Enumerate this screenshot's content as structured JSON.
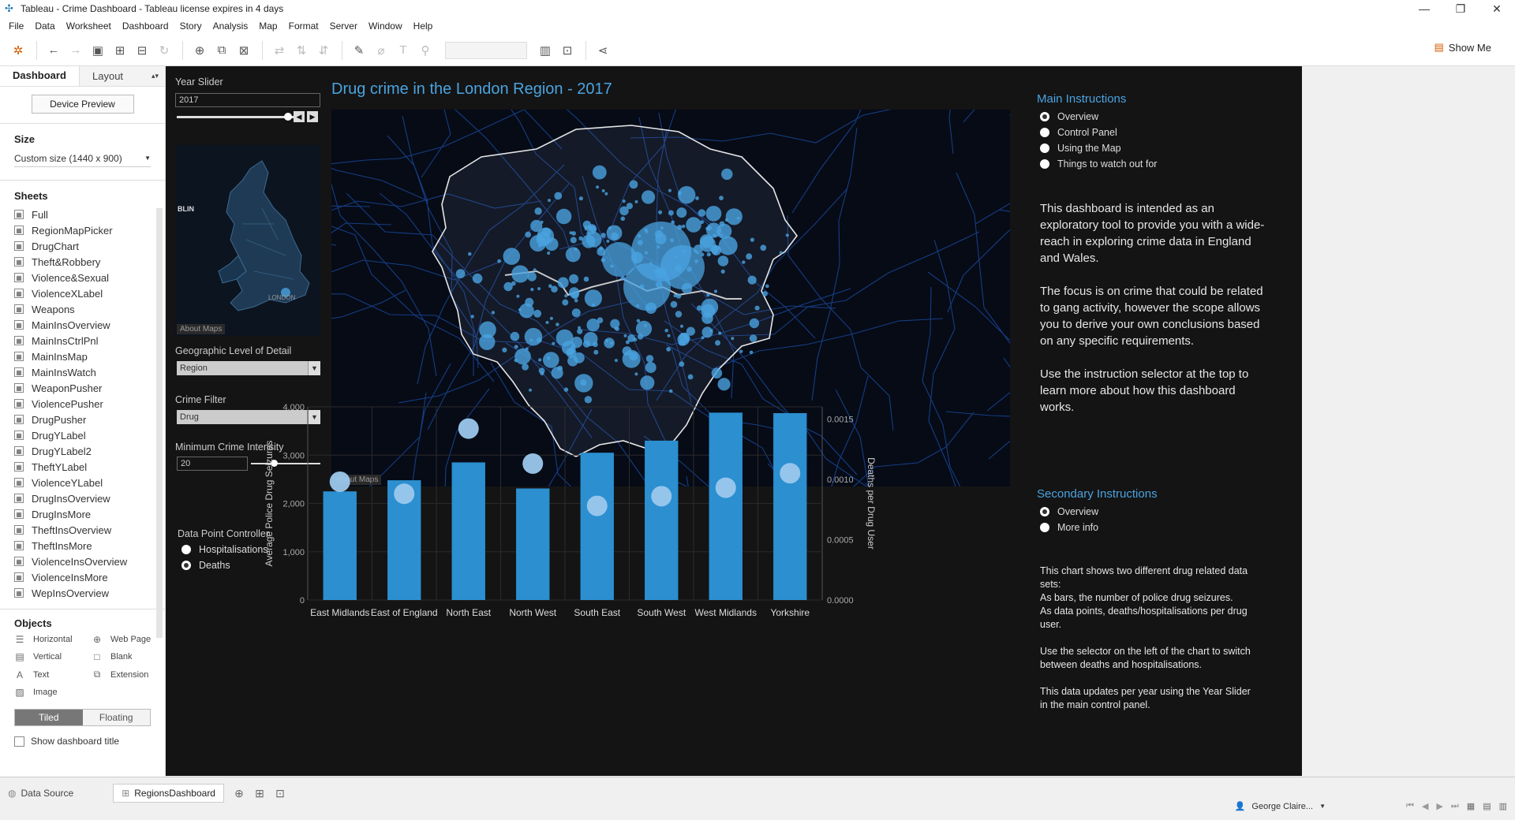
{
  "window": {
    "title": "Tableau - Crime Dashboard - Tableau license expires in 4 days",
    "controls": [
      "—",
      "❐",
      "✕"
    ]
  },
  "menu": [
    "File",
    "Data",
    "Worksheet",
    "Dashboard",
    "Story",
    "Analysis",
    "Map",
    "Format",
    "Server",
    "Window",
    "Help"
  ],
  "toolbar": {
    "show_me": "Show Me"
  },
  "left": {
    "tab_dashboard": "Dashboard",
    "tab_layout": "Layout",
    "device_preview": "Device Preview",
    "size_heading": "Size",
    "size_value": "Custom size (1440 x 900)",
    "sheets_heading": "Sheets",
    "sheets": [
      "Full",
      "RegionMapPicker",
      "DrugChart",
      "Theft&Robbery",
      "Violence&Sexual",
      "ViolenceXLabel",
      "Weapons",
      "MainInsOverview",
      "MainInsCtrlPnl",
      "MainInsMap",
      "MainInsWatch",
      "WeaponPusher",
      "ViolencePusher",
      "DrugPusher",
      "DrugYLabel",
      "DrugYLabel2",
      "TheftYLabel",
      "ViolenceYLabel",
      "DrugInsOverview",
      "DrugInsMore",
      "TheftInsOverview",
      "TheftInsMore",
      "ViolenceInsOverview",
      "ViolenceInsMore",
      "WepInsOverview"
    ],
    "objects_heading": "Objects",
    "objects": [
      {
        "label": "Horizontal",
        "icon": "horizontal-icon"
      },
      {
        "label": "Web Page",
        "icon": "globe-icon"
      },
      {
        "label": "Vertical",
        "icon": "vertical-icon"
      },
      {
        "label": "Blank",
        "icon": "blank-icon"
      },
      {
        "label": "Text",
        "icon": "text-icon"
      },
      {
        "label": "Extension",
        "icon": "extension-icon"
      },
      {
        "label": "Image",
        "icon": "image-icon"
      }
    ],
    "tiled": "Tiled",
    "floating": "Floating",
    "show_title": "Show dashboard title"
  },
  "dashboard": {
    "title": "Drug crime in the London Region - 2017",
    "year_slider_label": "Year Slider",
    "year_value": "2017",
    "minimap_labels": {
      "left": "BLIN",
      "right": "LONDON"
    },
    "about_maps": "About Maps",
    "geo_label": "Geographic Level of Detail",
    "geo_value": "Region",
    "crime_filter_label": "Crime Filter",
    "crime_filter_value": "Drug",
    "min_intensity_label": "Minimum Crime Intensity",
    "min_intensity_value": "20",
    "dpc_label": "Data Point Controller",
    "dpc_options": [
      "Hospitalisations",
      "Deaths"
    ],
    "dpc_selected": 1,
    "main_instr_title": "Main Instructions",
    "main_instr_options": [
      "Overview",
      "Control Panel",
      "Using the Map",
      "Things to watch out for"
    ],
    "main_instr_selected": 0,
    "main_text": [
      "This dashboard is intended as an exploratory tool to provide you with a wide-reach in exploring crime data in England and Wales.",
      "The focus is on crime that could be related to gang activity, however the scope allows you to derive your own conclusions based on any specific requirements.",
      "Use the instruction selector at the top to learn more about how this dashboard works."
    ],
    "sec_instr_title": "Secondary Instructions",
    "sec_instr_options": [
      "Overview",
      "More info"
    ],
    "sec_instr_selected": 0,
    "sec_text": [
      "This chart shows two different drug related data sets:",
      "As bars, the number of police drug seizures.",
      "As data points, deaths/hospitalisations per drug user.",
      "Use the selector on the left of the chart to switch between deaths and hospitalisations.",
      "This data updates per year using the Year Slider in the main control panel."
    ]
  },
  "chart_data": {
    "type": "bar",
    "categories": [
      "East Midlands",
      "East of England",
      "North East",
      "North West",
      "South East",
      "South West",
      "West Midlands",
      "Yorkshire"
    ],
    "series": [
      {
        "name": "Average Police Drug Seizures",
        "values": [
          2250,
          2480,
          2850,
          2310,
          3050,
          3300,
          3880,
          3870
        ],
        "axis": "left"
      },
      {
        "name": "Deaths per Drug User",
        "values": [
          0.00098,
          0.00088,
          0.00142,
          0.00113,
          0.00078,
          0.00086,
          0.00093,
          0.00105
        ],
        "axis": "right"
      }
    ],
    "ylabel": "Average Police Drug Seizures",
    "y2label": "Deaths per Drug User",
    "ylim": [
      0,
      4000
    ],
    "y2lim": [
      0,
      0.0016
    ],
    "yticks": [
      "0",
      "1,000",
      "2,000",
      "3,000",
      "4,000"
    ],
    "y2ticks": [
      "0.0000",
      "0.0005",
      "0.0010",
      "0.0015"
    ],
    "colors": {
      "bar": "#2b8fd0",
      "point": "#9cc8ec"
    }
  },
  "statusbar": {
    "data_source": "Data Source",
    "active_tab": "RegionsDashboard",
    "user": "George Claire..."
  }
}
